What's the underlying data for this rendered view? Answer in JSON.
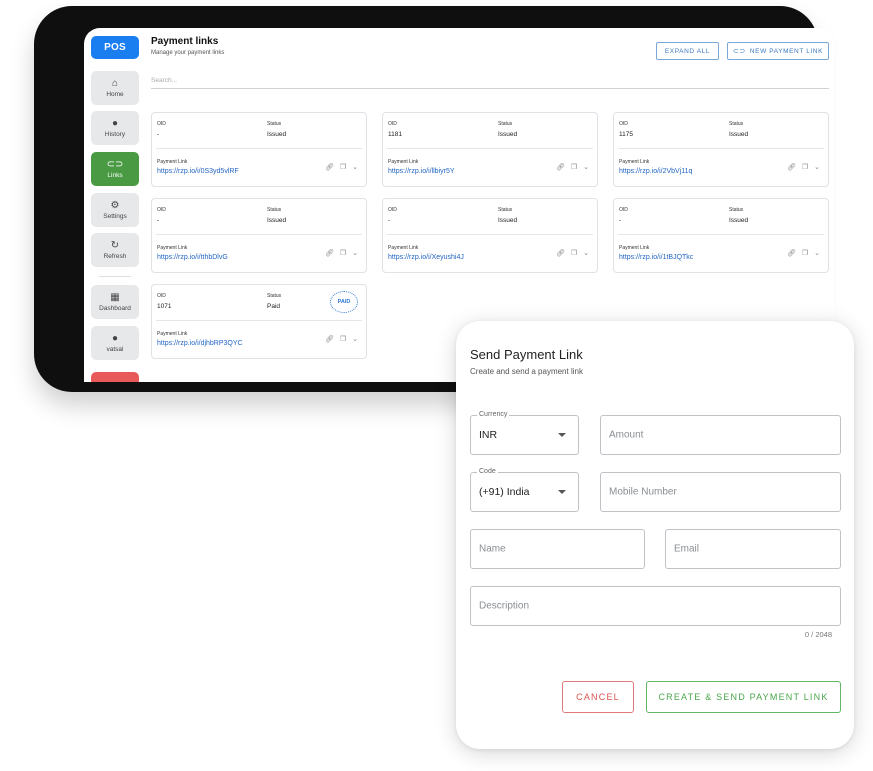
{
  "sidebar": {
    "brand": "POS",
    "items": [
      {
        "label": "Home",
        "icon": "home-icon"
      },
      {
        "label": "History",
        "icon": "clock-icon"
      },
      {
        "label": "Links",
        "icon": "link-icon",
        "active": true
      },
      {
        "label": "Settings",
        "icon": "gear-icon"
      },
      {
        "label": "Refresh",
        "icon": "refresh-icon"
      },
      {
        "label": "Dashboard",
        "icon": "grid-icon"
      },
      {
        "label": "vatsal",
        "icon": "user-icon"
      }
    ]
  },
  "header": {
    "title": "Payment links",
    "subtitle": "Manage your payment links",
    "expand_all": "EXPAND ALL",
    "new_link": "NEW PAYMENT LINK",
    "search_placeholder": "Search..."
  },
  "cards": [
    {
      "oid_label": "OID",
      "status_label": "Status",
      "link_label": "Payment Link",
      "oid": "-",
      "status": "Issued",
      "link": "https://rzp.io/i/0S3yd5vlRF"
    },
    {
      "oid_label": "OID",
      "status_label": "Status",
      "link_label": "Payment Link",
      "oid": "1181",
      "status": "Issued",
      "link": "https://rzp.io/i/llbiyr5Y"
    },
    {
      "oid_label": "OID",
      "status_label": "Status",
      "link_label": "Payment Link",
      "oid": "1175",
      "status": "Issued",
      "link": "https://rzp.io/i/2VbVj11q"
    },
    {
      "oid_label": "OID",
      "status_label": "Status",
      "link_label": "Payment Link",
      "oid": "-",
      "status": "Issued",
      "link": "https://rzp.io/i/tthbDlvG"
    },
    {
      "oid_label": "OID",
      "status_label": "Status",
      "link_label": "Payment Link",
      "oid": "-",
      "status": "Issued",
      "link": "https://rzp.io/i/Xeyushi4J"
    },
    {
      "oid_label": "OID",
      "status_label": "Status",
      "link_label": "Payment Link",
      "oid": "-",
      "status": "Issued",
      "link": "https://rzp.io/i/1tBJQTkc"
    },
    {
      "oid_label": "OID",
      "status_label": "Status",
      "link_label": "Payment Link",
      "oid": "1071",
      "status": "Paid",
      "link": "https://rzp.io/i/djhbRP3QYC",
      "badge": "PAID"
    }
  ],
  "modal": {
    "title": "Send Payment Link",
    "subtitle": "Create and send a payment link",
    "currency_label": "Currency",
    "currency_value": "INR",
    "amount_placeholder": "Amount",
    "code_label": "Code",
    "code_value": "(+91) India",
    "mobile_placeholder": "Mobile Number",
    "name_placeholder": "Name",
    "email_placeholder": "Email",
    "description_placeholder": "Description",
    "counter": "0 / 2048",
    "cancel": "CANCEL",
    "create": "CREATE & SEND PAYMENT LINK"
  },
  "colors": {
    "brand_blue": "#1a7df0",
    "active_green": "#4a9a44",
    "link_blue": "#2366c4",
    "cancel_red": "#d9534f",
    "create_green": "#4aa64a"
  }
}
